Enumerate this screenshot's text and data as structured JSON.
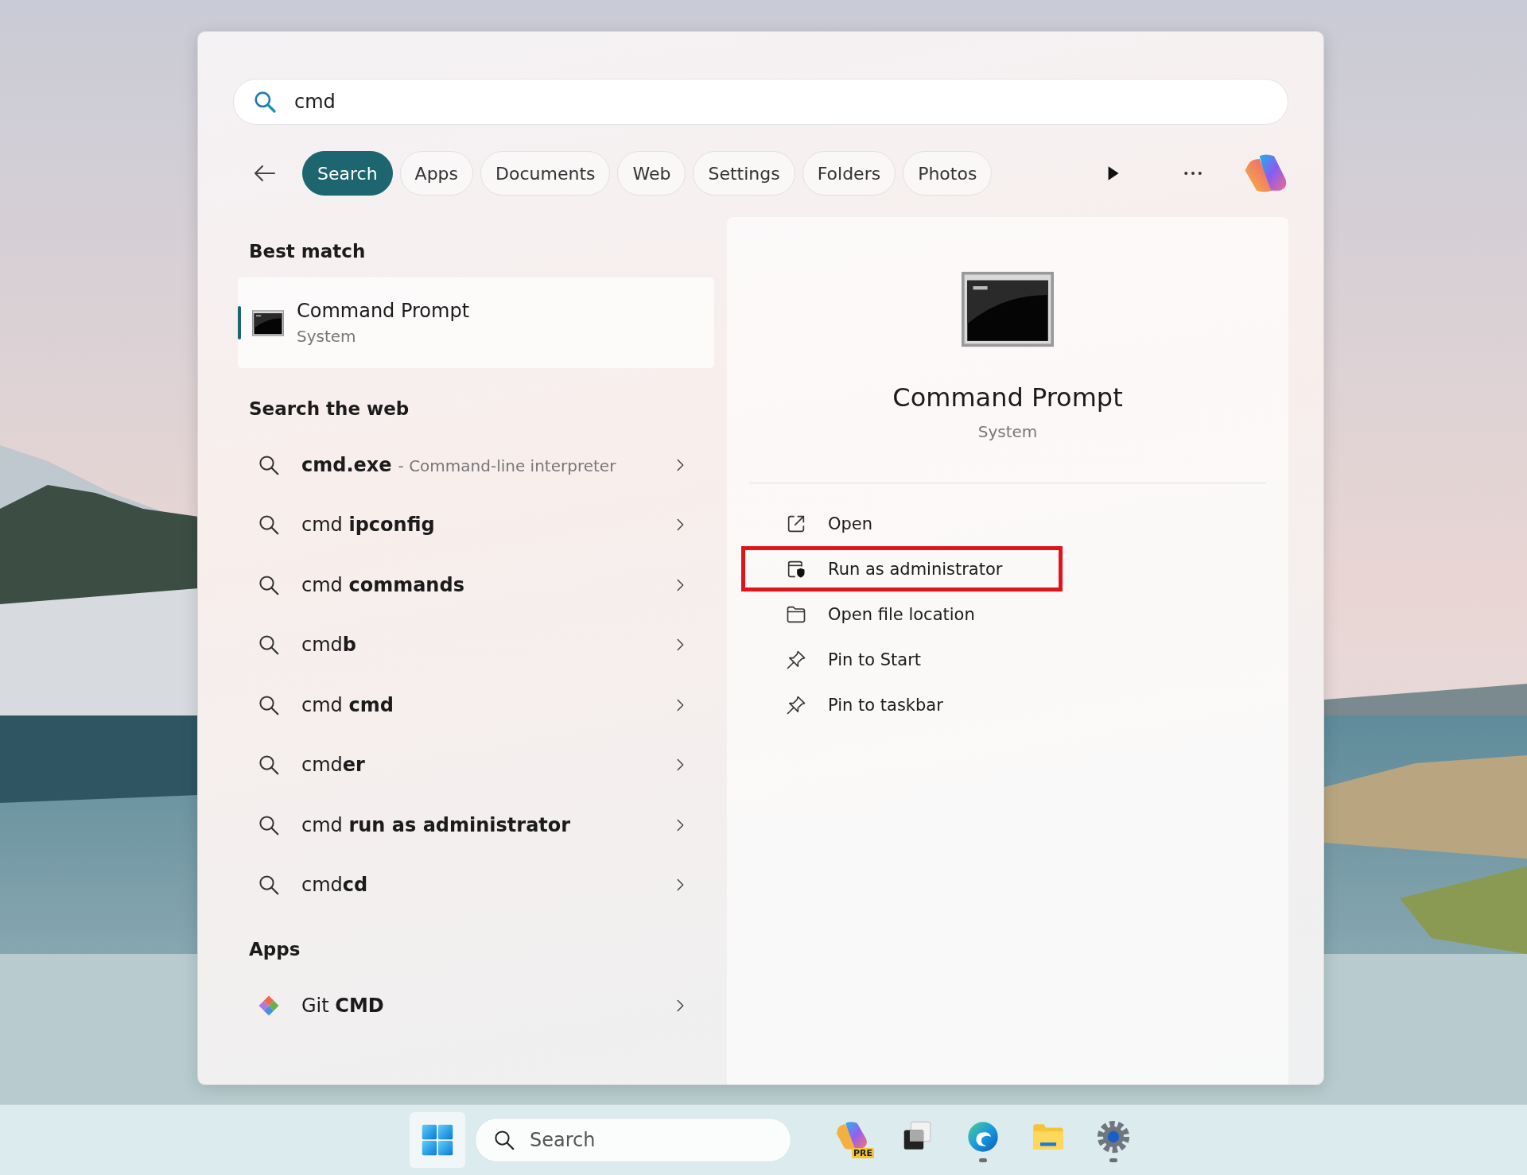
{
  "search_field": {
    "value": "cmd"
  },
  "filters": [
    {
      "label": "Search",
      "selected": true
    },
    {
      "label": "Apps",
      "selected": false
    },
    {
      "label": "Documents",
      "selected": false
    },
    {
      "label": "Web",
      "selected": false
    },
    {
      "label": "Settings",
      "selected": false
    },
    {
      "label": "Folders",
      "selected": false
    },
    {
      "label": "Photos",
      "selected": false
    }
  ],
  "best_match": {
    "heading": "Best match",
    "title": "Command Prompt",
    "subtitle": "System",
    "selected": true
  },
  "web_results": {
    "heading": "Search the web",
    "items": [
      {
        "text": "**cmd.exe**",
        "description": "- Command-line interpreter"
      },
      {
        "text": "cmd **ipconfig**"
      },
      {
        "text": "cmd **commands**"
      },
      {
        "text": "cmd**b**"
      },
      {
        "text": "cmd **cmd**"
      },
      {
        "text": "cmd**er**"
      },
      {
        "text": "cmd **run as administrator**"
      },
      {
        "text": "cmd**cd**"
      }
    ]
  },
  "apps": {
    "heading": "Apps",
    "items": [
      {
        "text": "Git **CMD**"
      }
    ]
  },
  "details": {
    "title": "Command Prompt",
    "subtitle": "System",
    "actions": [
      {
        "kind": "open",
        "label": "Open",
        "highlighted": false
      },
      {
        "kind": "admin",
        "label": "Run as administrator",
        "highlighted": true
      },
      {
        "kind": "folder",
        "label": "Open file location",
        "highlighted": false
      },
      {
        "kind": "pin",
        "label": "Pin to Start",
        "highlighted": false
      },
      {
        "kind": "pin",
        "label": "Pin to taskbar",
        "highlighted": false
      }
    ]
  },
  "taskbar": {
    "search": {
      "placeholder": "Search"
    },
    "apps": [
      {
        "kind": "copilot",
        "badge": "PRE",
        "running": false
      },
      {
        "kind": "taskview",
        "running": false
      },
      {
        "kind": "edge",
        "running": true
      },
      {
        "kind": "explorer",
        "running": false
      },
      {
        "kind": "settings",
        "running": true
      }
    ]
  }
}
